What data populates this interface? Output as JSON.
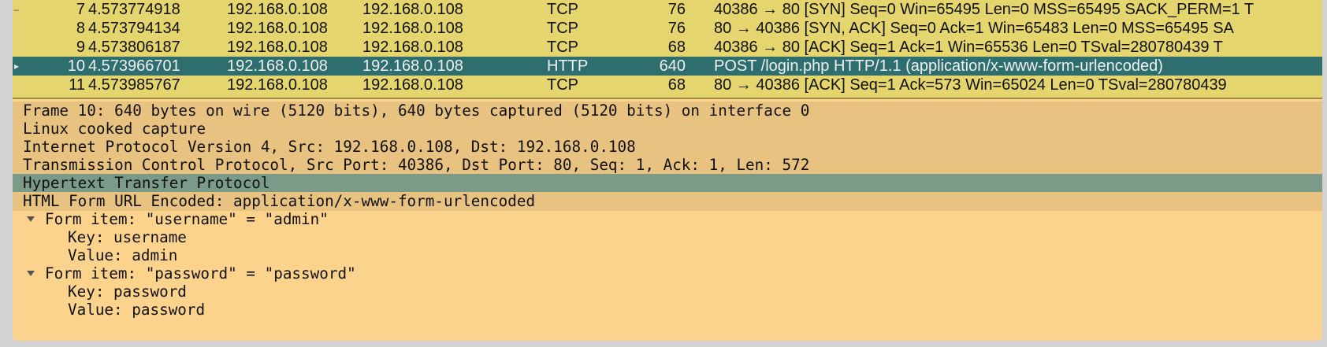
{
  "packets": [
    {
      "no": "7",
      "time": "4.573774918",
      "src": "192.168.0.108",
      "dst": "192.168.0.108",
      "proto": "TCP",
      "len": "76",
      "info": "40386 → 80 [SYN] Seq=0 Win=65495 Len=0 MSS=65495 SACK_PERM=1 T",
      "marker": "–"
    },
    {
      "no": "8",
      "time": "4.573794134",
      "src": "192.168.0.108",
      "dst": "192.168.0.108",
      "proto": "TCP",
      "len": "76",
      "info": "80 → 40386 [SYN, ACK] Seq=0 Ack=1 Win=65483 Len=0 MSS=65495 SA",
      "marker": ""
    },
    {
      "no": "9",
      "time": "4.573806187",
      "src": "192.168.0.108",
      "dst": "192.168.0.108",
      "proto": "TCP",
      "len": "68",
      "info": "40386 → 80 [ACK] Seq=1 Ack=1 Win=65536 Len=0 TSval=280780439 T",
      "marker": ""
    },
    {
      "no": "10",
      "time": "4.573966701",
      "src": "192.168.0.108",
      "dst": "192.168.0.108",
      "proto": "HTTP",
      "len": "640",
      "info": "POST /login.php HTTP/1.1  (application/x-www-form-urlencoded)",
      "marker": "▸"
    },
    {
      "no": "11",
      "time": "4.573985767",
      "src": "192.168.0.108",
      "dst": "192.168.0.108",
      "proto": "TCP",
      "len": "68",
      "info": "80 → 40386 [ACK] Seq=1 Ack=573 Win=65024 Len=0 TSval=280780439",
      "marker": ""
    }
  ],
  "details": [
    {
      "text": "Frame 10: 640 bytes on wire (5120 bits), 640 bytes captured (5120 bits) on interface 0"
    },
    {
      "text": "Linux cooked capture"
    },
    {
      "text": "Internet Protocol Version 4, Src: 192.168.0.108, Dst: 192.168.0.108"
    },
    {
      "text": "Transmission Control Protocol, Src Port: 40386, Dst Port: 80, Seq: 1, Ack: 1, Len: 572"
    },
    {
      "text": "Hypertext Transfer Protocol"
    },
    {
      "text": "HTML Form URL Encoded: application/x-www-form-urlencoded"
    },
    {
      "text": "Form item: \"username\" = \"admin\""
    },
    {
      "text": "Key: username"
    },
    {
      "text": "Value: admin"
    },
    {
      "text": "Form item: \"password\" = \"password\""
    },
    {
      "text": "Key: password"
    },
    {
      "text": "Value: password"
    }
  ],
  "colors": {
    "tcp_row": "#e4d56e",
    "selected_row": "#2e6e6e",
    "details_bg": "#fbd38d",
    "selected_detail": "#7a9b88"
  }
}
